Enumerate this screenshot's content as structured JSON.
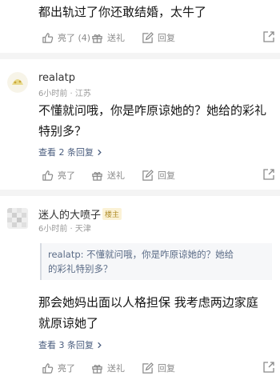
{
  "colors": {
    "text": "#151515",
    "meta": "#9a9a9a",
    "link": "#4a5d7e",
    "icon": "#8a8a8a",
    "badge_bg": "#fbf2d6",
    "badge_text": "#b08d2b"
  },
  "comment1": {
    "text": "都出轨过了你还敢结婚，太牛了",
    "actions": {
      "like": "亮了 (4)",
      "gift": "送礼",
      "reply": "回复"
    }
  },
  "comment2": {
    "username": "realatp",
    "meta": "6小时前 · 江苏",
    "line1": "不懂就问哦，你是咋原谅她的？她给的彩礼",
    "line2": "特别多？",
    "view_replies": "查看 2 条回复",
    "actions": {
      "like": "亮了",
      "gift": "送礼",
      "reply": "回复"
    }
  },
  "comment3": {
    "username": "迷人的大喷子",
    "badge": "楼主",
    "meta": "6小时前 · 天津",
    "quote_line1": "realatp: 不懂就问哦，你是咋原谅她的？她给",
    "quote_line2": "的彩礼特别多？",
    "line1": "那会她妈出面以人格担保 我考虑两边家庭",
    "line2": "就原谅她了",
    "view_replies": "查看 3 条回复",
    "actions": {
      "like": "亮了",
      "gift": "送礼",
      "reply": "回复"
    }
  },
  "icons": {
    "like": "thumbs-up-icon",
    "gift": "gift-icon",
    "reply": "edit-reply-icon",
    "share": "share-icon",
    "chevron": "chevron-right-icon"
  }
}
